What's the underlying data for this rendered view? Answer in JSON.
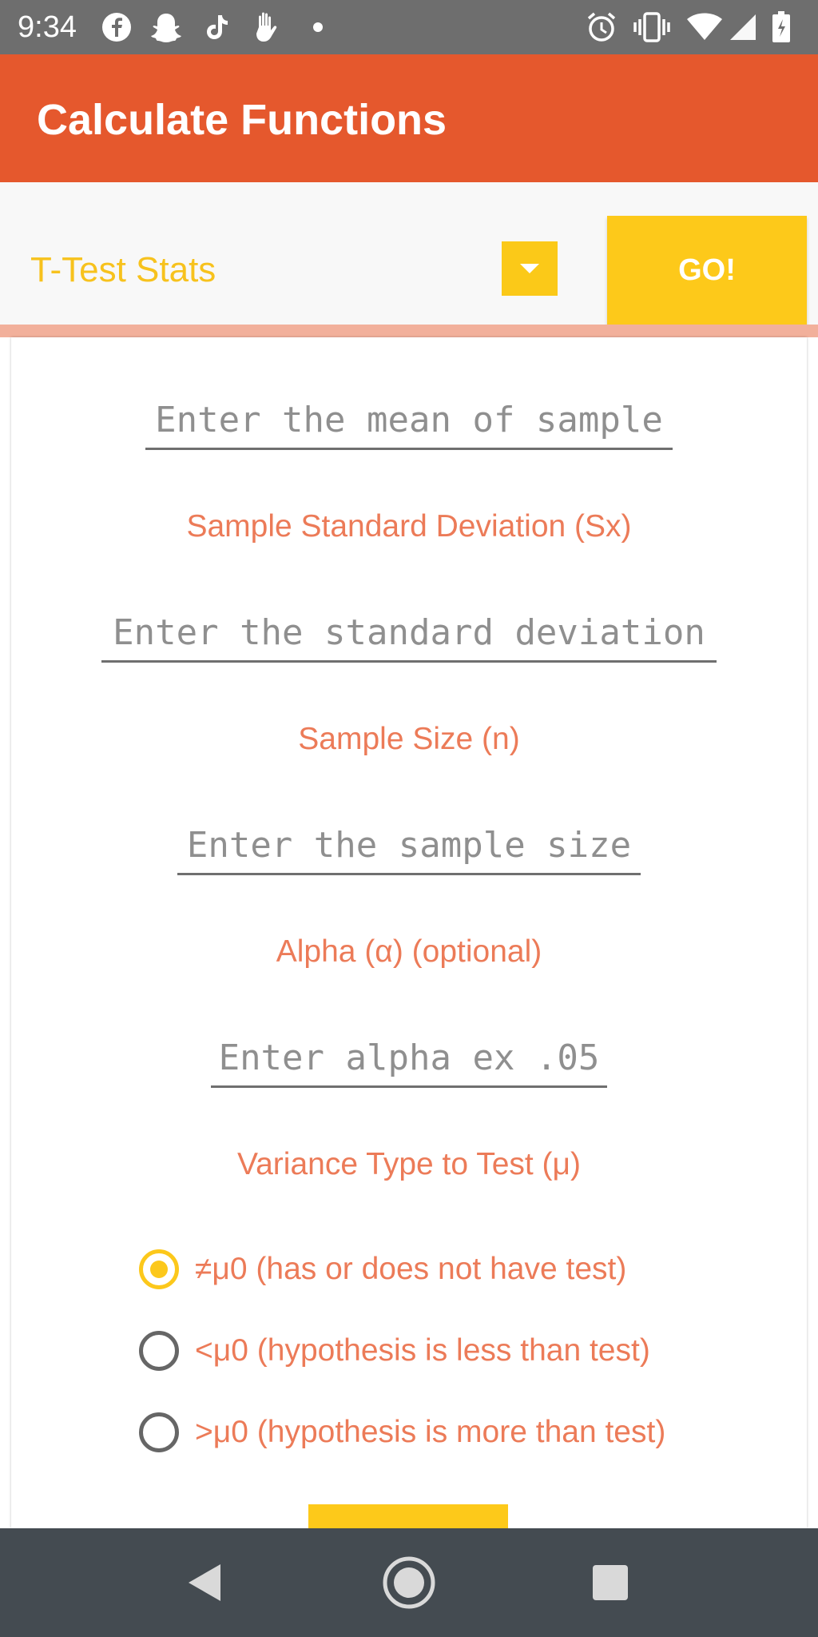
{
  "status_bar": {
    "time": "9:34",
    "left_icons": [
      "facebook-icon",
      "snapchat-icon",
      "tiktok-icon",
      "hand-icon",
      "dot-icon"
    ],
    "right_icons": [
      "alarm-icon",
      "vibrate-icon",
      "wifi-icon",
      "signal-icon",
      "battery-icon"
    ]
  },
  "app_bar": {
    "title": "Calculate Functions",
    "color": "#e5582d"
  },
  "selector": {
    "selected": "T-Test Stats",
    "go_label": "GO!"
  },
  "form": {
    "mean_placeholder": "Enter the mean of sample",
    "sd_label": "Sample Standard Deviation (Sx)",
    "sd_placeholder": "Enter the standard deviation",
    "n_label": "Sample Size (n)",
    "n_placeholder": "Enter the sample size",
    "alpha_label": "Alpha (α) (optional)",
    "alpha_placeholder": "Enter alpha ex .05",
    "variance_label": "Variance Type to Test (μ)",
    "options": [
      {
        "label": "≠μ0 (has or does not have test)",
        "checked": true
      },
      {
        "label": "<μ0 (hypothesis is less than test)",
        "checked": false
      },
      {
        "label": ">μ0 (hypothesis is more than test)",
        "checked": false
      }
    ]
  },
  "colors": {
    "accent": "#fcc81b",
    "label_text": "#ec7b58",
    "divider": "#f2b09b",
    "nav_bar": "#444b51"
  }
}
